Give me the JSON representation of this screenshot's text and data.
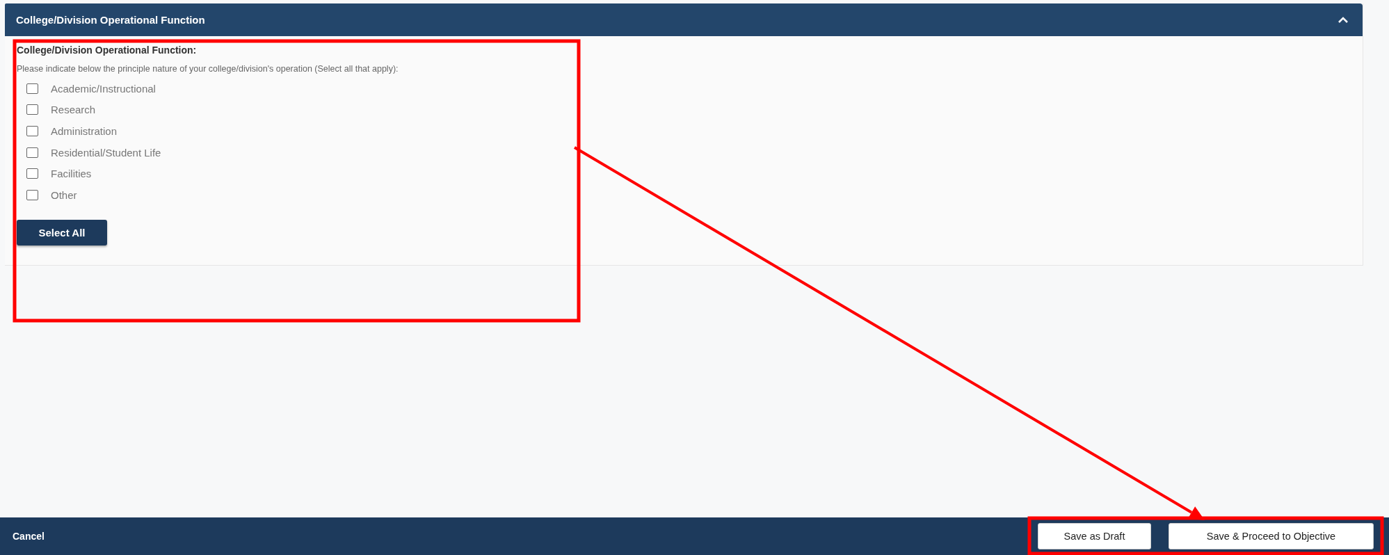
{
  "panel": {
    "title": "College/Division Operational Function",
    "expanded": true,
    "heading": "College/Division Operational Function:",
    "instruction": "Please indicate below the principle nature of your college/division's operation (Select all that apply):",
    "options": [
      {
        "label": "Academic/Instructional",
        "checked": false
      },
      {
        "label": "Research",
        "checked": false
      },
      {
        "label": "Administration",
        "checked": false
      },
      {
        "label": "Residential/Student Life",
        "checked": false
      },
      {
        "label": "Facilities",
        "checked": false
      },
      {
        "label": "Other",
        "checked": false
      }
    ],
    "select_all_button": "Select All"
  },
  "footer": {
    "cancel": "Cancel",
    "buttons": [
      "Save as Draft",
      "Save & Proceed to Objective"
    ]
  },
  "annotations": [
    {
      "kind": "frame"
    },
    {
      "kind": "frame"
    },
    {
      "kind": "arrow"
    }
  ]
}
